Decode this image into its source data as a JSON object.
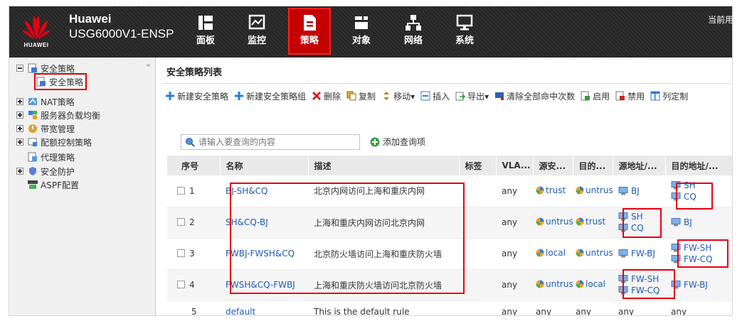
{
  "app": {
    "brand_line1": "Huawei",
    "brand_line2": "USG6000V1-ENSP",
    "logo_text": "HUAWEI",
    "user_text": "当前用"
  },
  "nav": [
    {
      "label": "面板",
      "icon": "dashboard-icon"
    },
    {
      "label": "监控",
      "icon": "monitor-icon"
    },
    {
      "label": "策略",
      "icon": "policy-document-icon",
      "active": true
    },
    {
      "label": "对象",
      "icon": "objects-icon"
    },
    {
      "label": "网络",
      "icon": "network-icon"
    },
    {
      "label": "系统",
      "icon": "system-icon"
    }
  ],
  "sidebar": {
    "collapse": "«",
    "items": [
      {
        "label": "安全策略",
        "expander": "minus"
      },
      {
        "label": "安全策略",
        "selected": true
      },
      {
        "label": "NAT策略",
        "expander": "plus"
      },
      {
        "label": "服务器负载均衡",
        "expander": "plus"
      },
      {
        "label": "带宽管理",
        "expander": "plus"
      },
      {
        "label": "配额控制策略",
        "expander": "plus"
      },
      {
        "label": "代理策略"
      },
      {
        "label": "安全防护",
        "expander": "plus"
      },
      {
        "label": "ASPF配置"
      }
    ]
  },
  "main": {
    "title": "安全策略列表",
    "toolbar": [
      {
        "label": "新建安全策略",
        "icon": "add-icon"
      },
      {
        "label": "新建安全策略组",
        "icon": "add-group-icon"
      },
      {
        "label": "删除",
        "icon": "delete-icon"
      },
      {
        "label": "复制",
        "icon": "copy-icon"
      },
      {
        "label": "移动▾",
        "icon": "move-icon"
      },
      {
        "label": "插入",
        "icon": "insert-icon"
      },
      {
        "label": "导出▾",
        "icon": "export-icon"
      },
      {
        "label": "清除全部命中次数",
        "icon": "clear-hits-icon"
      },
      {
        "label": "启用",
        "icon": "enable-icon"
      },
      {
        "label": "禁用",
        "icon": "disable-icon"
      },
      {
        "label": "列定制",
        "icon": "column-custom-icon"
      }
    ],
    "search_placeholder": "请输入要查询的内容",
    "add_query": "添加查询项"
  },
  "table": {
    "columns": [
      "序号",
      "名称",
      "描述",
      "标签",
      "VLA...",
      "源安...",
      "目的...",
      "源地址/...",
      "目的地址/..."
    ],
    "rows": [
      {
        "no": "1",
        "name": "BJ-SH&CQ",
        "desc": "北京内网访问上海和重庆内网",
        "tag": "",
        "vlan": "any",
        "src_zone": "trust",
        "dst_zone": "untrust",
        "src_addr": [
          "BJ"
        ],
        "dst_addr": [
          "SH",
          "CQ"
        ]
      },
      {
        "no": "2",
        "name": "SH&CQ-BJ",
        "desc": "上海和重庆内网访问北京内网",
        "tag": "",
        "vlan": "any",
        "src_zone": "untrust",
        "dst_zone": "trust",
        "src_addr": [
          "SH",
          "CQ"
        ],
        "dst_addr": [
          "BJ"
        ]
      },
      {
        "no": "3",
        "name": "FWBJ-FWSH&CQ",
        "desc": "北京防火墙访问上海和重庆防火墙",
        "tag": "",
        "vlan": "any",
        "src_zone": "local",
        "dst_zone": "untrust",
        "src_addr": [
          "FW-BJ"
        ],
        "dst_addr": [
          "FW-SH",
          "FW-CQ"
        ]
      },
      {
        "no": "4",
        "name": "FWSH&CQ-FWBJ",
        "desc": "上海和重庆防火墙访问北京防火墙",
        "tag": "",
        "vlan": "any",
        "src_zone": "untrust",
        "dst_zone": "local",
        "src_addr": [
          "FW-SH",
          "FW-CQ"
        ],
        "dst_addr": [
          "FW-BJ"
        ]
      },
      {
        "no": "5",
        "name": "default",
        "desc": "This is the default rule",
        "tag": "",
        "vlan": "any",
        "src_zone": "any",
        "dst_zone": "any",
        "src_addr": [
          "any"
        ],
        "dst_addr": [
          "any"
        ]
      }
    ]
  },
  "colors": {
    "header_bg": "#2b2b2b",
    "accent_red": "#c50000",
    "highlight_red": "#e60012",
    "link_blue": "#1f5bb6"
  }
}
